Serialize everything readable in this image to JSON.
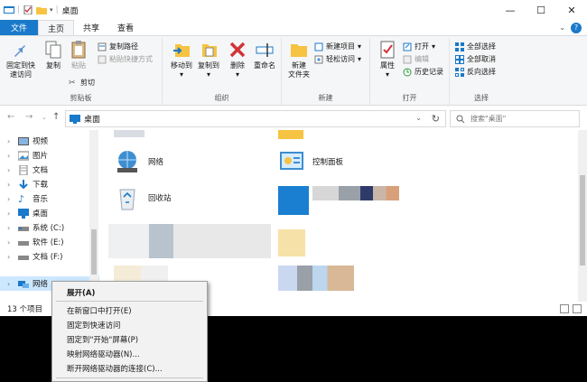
{
  "window": {
    "title": "桌面"
  },
  "tabs": [
    {
      "label": "文件"
    },
    {
      "label": "主页"
    },
    {
      "label": "共享"
    },
    {
      "label": "查看"
    }
  ],
  "ribbon": {
    "clipboard": {
      "pin_label": "固定到快速访问",
      "pin_line1": "固定到快",
      "pin_line2": "速访问",
      "copy": "复制",
      "paste": "粘贴",
      "copy_path": "复制路径",
      "paste_shortcut": "粘贴快捷方式",
      "cut": "剪切",
      "group": "剪贴板"
    },
    "organize": {
      "move_to": "移动到",
      "copy_to": "复制到",
      "delete": "删除",
      "rename": "重命名",
      "group": "组织"
    },
    "new": {
      "new_folder_line1": "新建",
      "new_folder_line2": "文件夹",
      "new_item": "新建项目",
      "easy_access": "轻松访问",
      "group": "新建"
    },
    "open": {
      "properties": "属性",
      "open": "打开",
      "edit": "编辑",
      "history": "历史记录",
      "group": "打开"
    },
    "select": {
      "select_all": "全部选择",
      "select_none": "全部取消",
      "invert": "反向选择",
      "group": "选择"
    }
  },
  "address": {
    "path": "桌面"
  },
  "search": {
    "placeholder": "搜索\"桌面\""
  },
  "navpane": {
    "items": [
      {
        "label": "视频"
      },
      {
        "label": "图片"
      },
      {
        "label": "文档"
      },
      {
        "label": "下载"
      },
      {
        "label": "音乐"
      },
      {
        "label": "桌面"
      },
      {
        "label": "系统 (C:)"
      },
      {
        "label": "软件 (E:)"
      },
      {
        "label": "文档 (F:)"
      },
      {
        "label": "网络"
      }
    ]
  },
  "content": {
    "items": [
      {
        "label": "网络"
      },
      {
        "label": "控制面板"
      },
      {
        "label": "回收站"
      }
    ]
  },
  "status": {
    "count": "13 个项目"
  },
  "context_menu": {
    "items": [
      {
        "label": "展开(A)"
      },
      {
        "label": "在新窗口中打开(E)"
      },
      {
        "label": "固定到快速访问"
      },
      {
        "label": "固定到\"开始\"屏幕(P)"
      },
      {
        "label": "映射网络驱动器(N)..."
      },
      {
        "label": "断开网络驱动器的连接(C)..."
      }
    ]
  },
  "colors": {
    "accent": "#1979ca",
    "selection": "#cce8ff",
    "folder": "#f6c342"
  }
}
